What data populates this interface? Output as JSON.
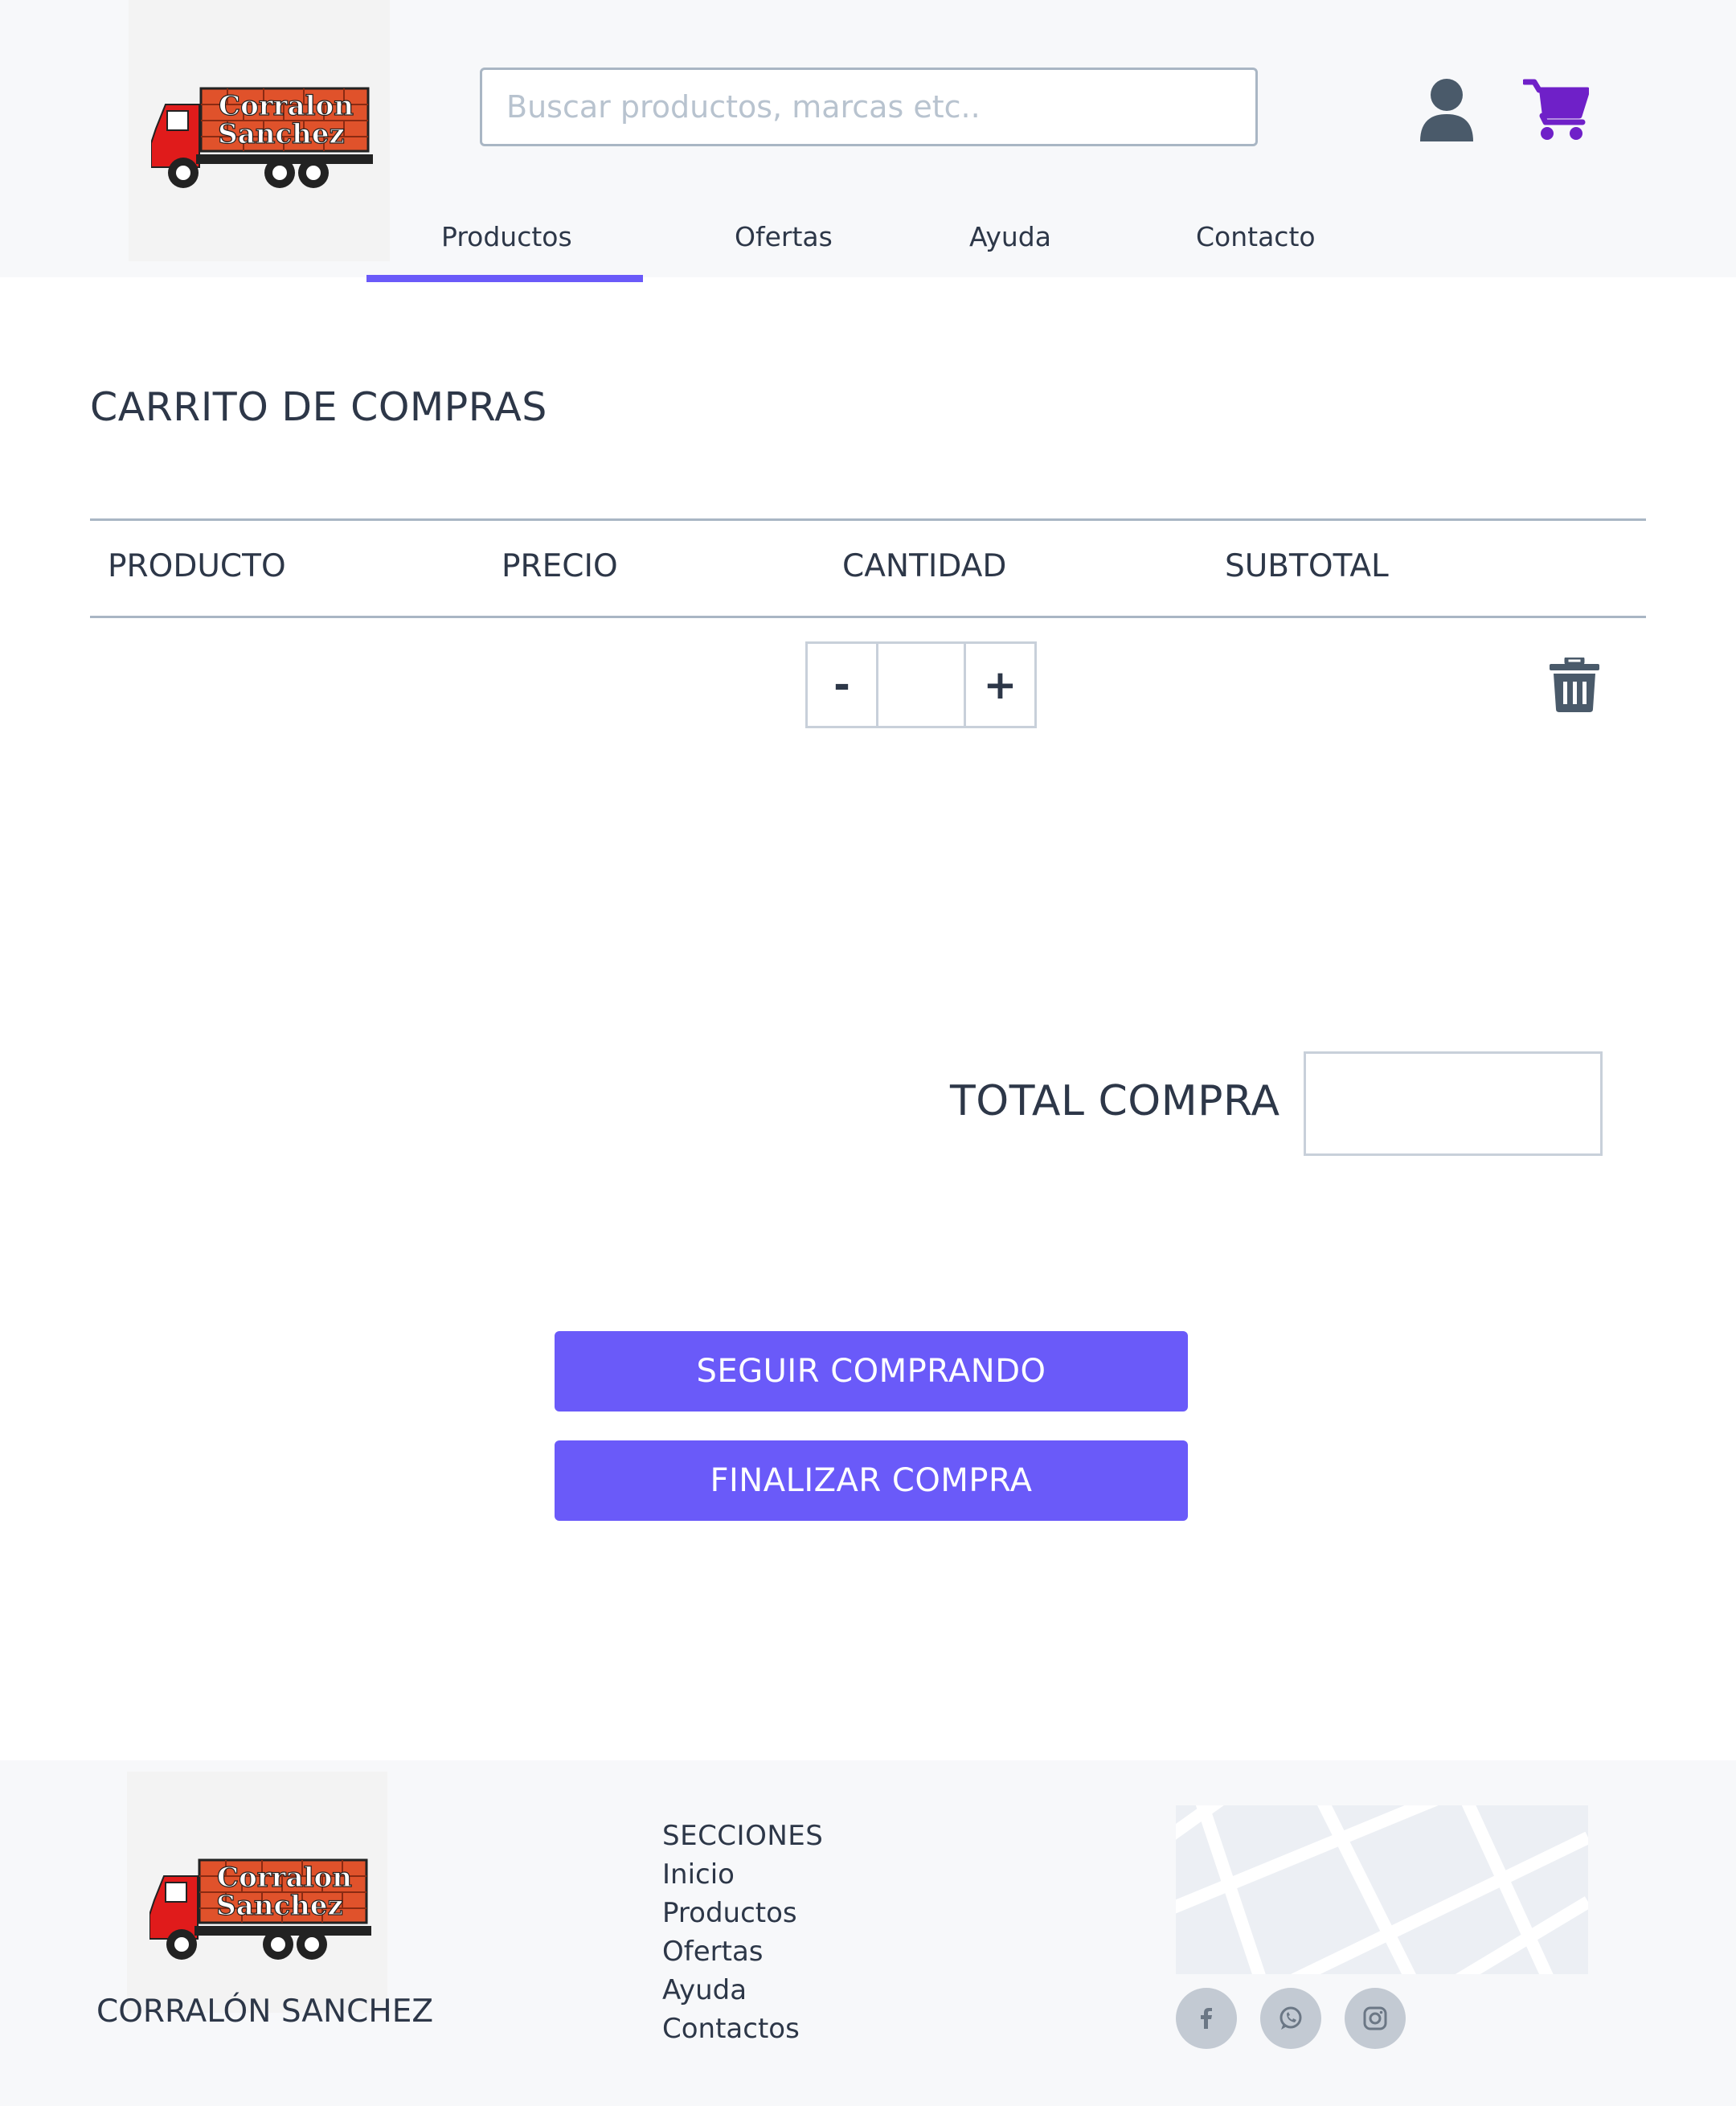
{
  "header": {
    "logo_line1": "Corralon",
    "logo_line2": "Sanchez",
    "search_placeholder": "Buscar productos, marcas etc..",
    "user_icon": "user-icon",
    "cart_icon": "cart-icon",
    "cart_color": "#6f20c8"
  },
  "nav": {
    "items": [
      {
        "label": "Productos",
        "active": true
      },
      {
        "label": "Ofertas"
      },
      {
        "label": "Ayuda"
      },
      {
        "label": "Contacto"
      }
    ],
    "accent": "#6a5af9"
  },
  "cart": {
    "title": "CARRITO DE COMPRAS",
    "columns": [
      "PRODUCTO",
      "PRECIO",
      "CANTIDAD",
      "SUBTOTAL"
    ],
    "row": {
      "minus_label": "-",
      "quantity": "",
      "plus_label": "+",
      "delete_icon": "trash-icon"
    },
    "total_label": "TOTAL COMPRA",
    "total_value": "",
    "continue_label": "SEGUIR COMPRANDO",
    "checkout_label": "FINALIZAR COMPRA"
  },
  "footer": {
    "logo_line1": "Corralon",
    "logo_line2": "Sanchez",
    "brand": "CORRALÓN SANCHEZ",
    "sections_title": "SECCIONES",
    "links": [
      "Inicio",
      "Productos",
      "Ofertas",
      "Ayuda",
      "Contactos"
    ],
    "social": [
      "facebook-icon",
      "whatsapp-icon",
      "instagram-icon"
    ]
  }
}
